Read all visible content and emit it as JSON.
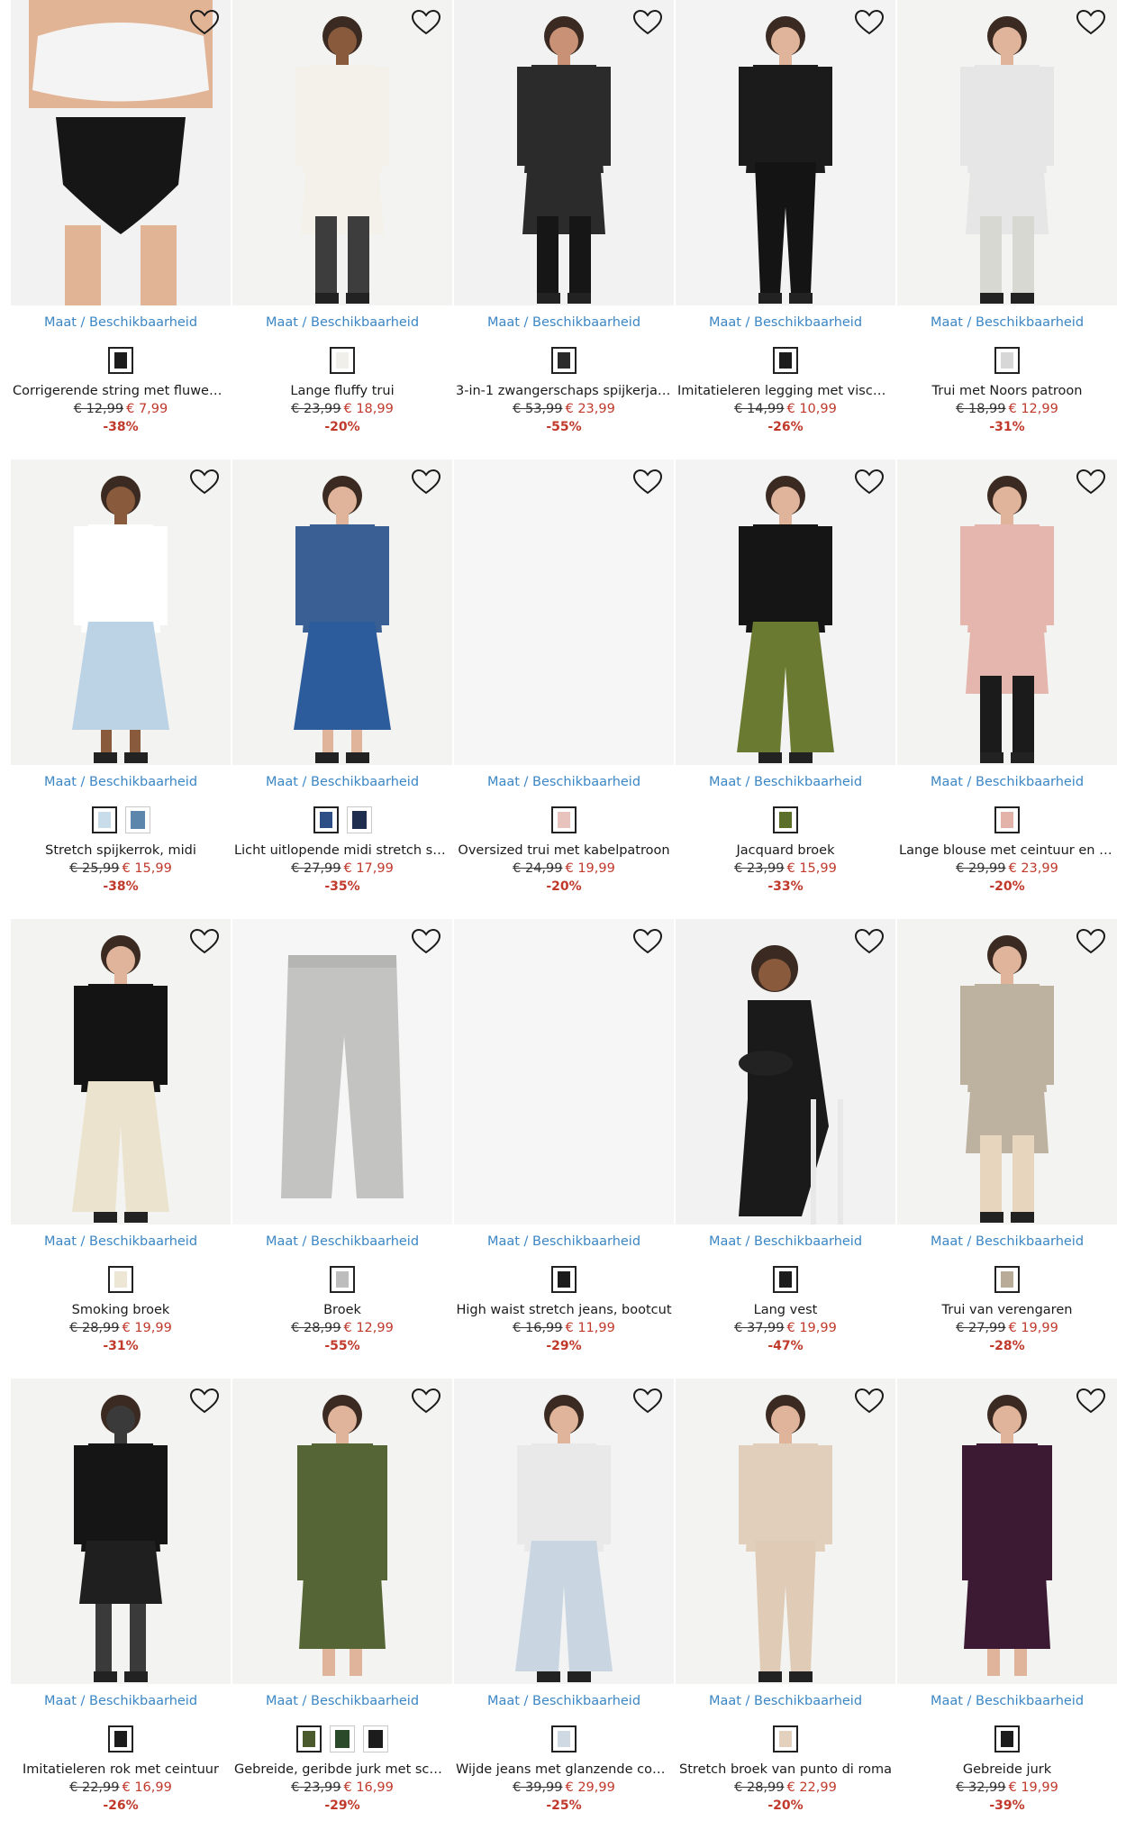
{
  "products": [
    {
      "size_link": "Maat / Beschikbaarheid",
      "name": "Corrigerende string met fluweel, ...",
      "old_price": "€ 12,99",
      "new_price": "€ 7,99",
      "discount": "-38%",
      "swatches": [
        "#1c1c1c"
      ],
      "figure": {
        "top": "#f4f4f4",
        "bottom": "#161616",
        "skin": "#e2b496",
        "kind": "brief",
        "bg": "#f2f2f2"
      }
    },
    {
      "size_link": "Maat / Beschikbaarheid",
      "name": "Lange fluffy trui",
      "old_price": "€ 23,99",
      "new_price": "€ 18,99",
      "discount": "-20%",
      "swatches": [
        "#f1efe9"
      ],
      "figure": {
        "top": "#f3f1ea",
        "bottom": "#3d3d3d",
        "skin": "#8a5a3c",
        "kind": "sweater",
        "bg": "#f3f3f1"
      }
    },
    {
      "size_link": "Maat / Beschikbaarheid",
      "name": "3-in-1 zwangerschaps spijkerjas / dr...",
      "old_price": "€ 53,99",
      "new_price": "€ 23,99",
      "discount": "-55%",
      "swatches": [
        "#2a2a2a"
      ],
      "figure": {
        "top": "#2b2b2b",
        "bottom": "#161616",
        "skin": "#c99277",
        "kind": "jacket",
        "bg": "#f2f2f2"
      }
    },
    {
      "size_link": "Maat / Beschikbaarheid",
      "name": "Imitatieleren legging met viscose",
      "old_price": "€ 14,99",
      "new_price": "€ 10,99",
      "discount": "-26%",
      "swatches": [
        "#1c1c1c"
      ],
      "figure": {
        "top": "#1b1b1b",
        "bottom": "#141414",
        "skin": "#e0b49a",
        "kind": "legging",
        "bg": "#f3f3f3"
      }
    },
    {
      "size_link": "Maat / Beschikbaarheid",
      "name": "Trui met Noors patroon",
      "old_price": "€ 18,99",
      "new_price": "€ 12,99",
      "discount": "-31%",
      "swatches": [
        "#d7d7d7"
      ],
      "figure": {
        "top": "#e6e6e6",
        "bottom": "#d8d8d2",
        "skin": "#e0b49a",
        "kind": "coat",
        "bg": "#f3f3f1"
      }
    },
    {
      "size_link": "Maat / Beschikbaarheid",
      "name": "Stretch spijkerrok, midi",
      "old_price": "€ 25,99",
      "new_price": "€ 15,99",
      "discount": "-38%",
      "swatches": [
        "#c9dce9",
        "#5d86ad"
      ],
      "figure": {
        "top": "#ffffff",
        "bottom": "#bcd3e6",
        "skin": "#8a5a3c",
        "kind": "skirt",
        "bg": "#f3f3f1"
      }
    },
    {
      "size_link": "Maat / Beschikbaarheid",
      "name": "Licht uitlopende midi stretch spijke...",
      "old_price": "€ 27,99",
      "new_price": "€ 17,99",
      "discount": "-35%",
      "swatches": [
        "#2d4f86",
        "#1f2d4e"
      ],
      "figure": {
        "top": "#3a5f94",
        "bottom": "#2c5c9c",
        "skin": "#e0b49a",
        "kind": "skirt",
        "bg": "#f3f3f1"
      }
    },
    {
      "size_link": "Maat / Beschikbaarheid",
      "name": "Oversized trui met kabelpatroon",
      "old_price": "€ 24,99",
      "new_price": "€ 19,99",
      "discount": "-20%",
      "swatches": [
        "#e8c3bd"
      ],
      "figure": {
        "kind": "none",
        "bg": "#f6f6f6"
      }
    },
    {
      "size_link": "Maat / Beschikbaarheid",
      "name": "Jacquard broek",
      "old_price": "€ 23,99",
      "new_price": "€ 15,99",
      "discount": "-33%",
      "swatches": [
        "#5b6e2a"
      ],
      "figure": {
        "top": "#151515",
        "bottom": "#6a7b31",
        "skin": "#e0b49a",
        "kind": "flare",
        "bg": "#f3f3f3"
      }
    },
    {
      "size_link": "Maat / Beschikbaarheid",
      "name": "Lange blouse met ceintuur en gere...",
      "old_price": "€ 29,99",
      "new_price": "€ 23,99",
      "discount": "-20%",
      "swatches": [
        "#e3b3aa"
      ],
      "figure": {
        "top": "#e4b6ad",
        "bottom": "#1b1b1b",
        "skin": "#e0b49a",
        "kind": "blouse",
        "bg": "#f3f3f1"
      }
    },
    {
      "size_link": "Maat / Beschikbaarheid",
      "name": "Smoking broek",
      "old_price": "€ 28,99",
      "new_price": "€ 19,99",
      "discount": "-31%",
      "swatches": [
        "#eee6d4"
      ],
      "figure": {
        "top": "#141414",
        "bottom": "#ece3cf",
        "skin": "#e0b49a",
        "kind": "wide",
        "bg": "#f3f3f1"
      }
    },
    {
      "size_link": "Maat / Beschikbaarheid",
      "name": "Broek",
      "old_price": "€ 28,99",
      "new_price": "€ 12,99",
      "discount": "-55%",
      "swatches": [
        "#bdbdbd"
      ],
      "figure": {
        "bottom": "#c3c3c1",
        "kind": "flatpants",
        "bg": "#f6f6f6"
      }
    },
    {
      "size_link": "Maat / Beschikbaarheid",
      "name": "High waist stretch jeans, bootcut",
      "old_price": "€ 16,99",
      "new_price": "€ 11,99",
      "discount": "-29%",
      "swatches": [
        "#1c1c1c"
      ],
      "figure": {
        "kind": "none",
        "bg": "#f6f6f6"
      }
    },
    {
      "size_link": "Maat / Beschikbaarheid",
      "name": "Lang vest",
      "old_price": "€ 37,99",
      "new_price": "€ 19,99",
      "discount": "-47%",
      "swatches": [
        "#1c1c1c"
      ],
      "figure": {
        "top": "#1a1a1a",
        "bottom": "#1a1a1a",
        "skin": "#8a5a3c",
        "kind": "seated",
        "bg": "#f2f2f2"
      }
    },
    {
      "size_link": "Maat / Beschikbaarheid",
      "name": "Trui van verengaren",
      "old_price": "€ 27,99",
      "new_price": "€ 19,99",
      "discount": "-28%",
      "swatches": [
        "#b8ab98"
      ],
      "figure": {
        "top": "#bdb19f",
        "bottom": "#e7d6bd",
        "skin": "#e0b49a",
        "kind": "knit",
        "bg": "#f3f3f1"
      }
    },
    {
      "size_link": "Maat / Beschikbaarheid",
      "name": "Imitatieleren rok met ceintuur",
      "old_price": "€ 22,99",
      "new_price": "€ 16,99",
      "discount": "-26%",
      "swatches": [
        "#1c1c1c"
      ],
      "figure": {
        "top": "#151515",
        "bottom": "#1f1f1f",
        "skin": "#3a3a3a",
        "kind": "mini",
        "bg": "#f3f3f1"
      }
    },
    {
      "size_link": "Maat / Beschikbaarheid",
      "name": "Gebreide, geribde jurk met schippe...",
      "old_price": "€ 23,99",
      "new_price": "€ 16,99",
      "discount": "-29%",
      "swatches": [
        "#4b5a2c",
        "#2a4a2a",
        "#1c1c1c"
      ],
      "figure": {
        "top": "#556536",
        "bottom": "#556536",
        "skin": "#e0b49a",
        "kind": "dress",
        "bg": "#f3f3f1"
      }
    },
    {
      "size_link": "Maat / Beschikbaarheid",
      "name": "Wijde jeans met glanzende coating",
      "old_price": "€ 39,99",
      "new_price": "€ 29,99",
      "discount": "-25%",
      "swatches": [
        "#cfd9e3"
      ],
      "figure": {
        "top": "#e9e9e9",
        "bottom": "#c9d6e2",
        "skin": "#e0b49a",
        "kind": "wide",
        "bg": "#f3f3f3"
      }
    },
    {
      "size_link": "Maat / Beschikbaarheid",
      "name": "Stretch broek van punto di roma",
      "old_price": "€ 28,99",
      "new_price": "€ 22,99",
      "discount": "-20%",
      "swatches": [
        "#e3d1bd"
      ],
      "figure": {
        "top": "#e2cfbb",
        "bottom": "#e0ccb6",
        "skin": "#e0b49a",
        "kind": "jogger",
        "bg": "#f3f3f1"
      }
    },
    {
      "size_link": "Maat / Beschikbaarheid",
      "name": "Gebreide jurk",
      "old_price": "€ 32,99",
      "new_price": "€ 19,99",
      "discount": "-39%",
      "swatches": [
        "#1c1c1c"
      ],
      "figure": {
        "top": "#3c1a33",
        "bottom": "#3c1a33",
        "skin": "#e0b49a",
        "kind": "dress",
        "bg": "#f3f3f1"
      }
    }
  ],
  "colors": {
    "link": "#3b86c4",
    "sale": "#c0392b",
    "text": "#1a1a1a"
  },
  "icons": {
    "wishlist": "heart-outline-icon"
  }
}
